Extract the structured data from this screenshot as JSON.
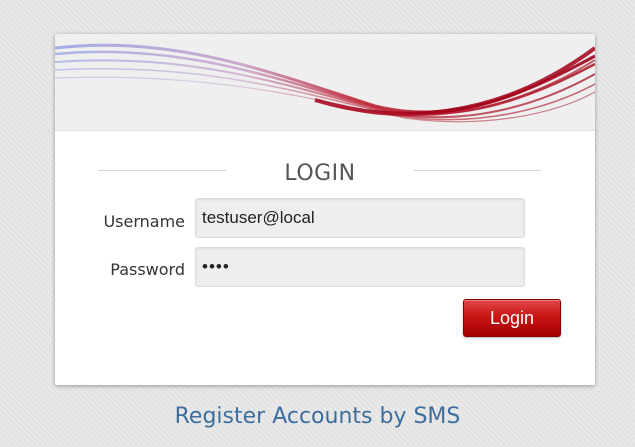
{
  "form": {
    "title": "LOGIN",
    "username_label": "Username",
    "username_value": "testuser@local",
    "password_label": "Password",
    "password_value": "••••",
    "login_button_label": "Login"
  },
  "footer": {
    "register_link_label": "Register Accounts by SMS"
  },
  "colors": {
    "accent_red": "#c91515",
    "link_blue": "#3d6e9e",
    "banner_wave": "#b8102a"
  }
}
